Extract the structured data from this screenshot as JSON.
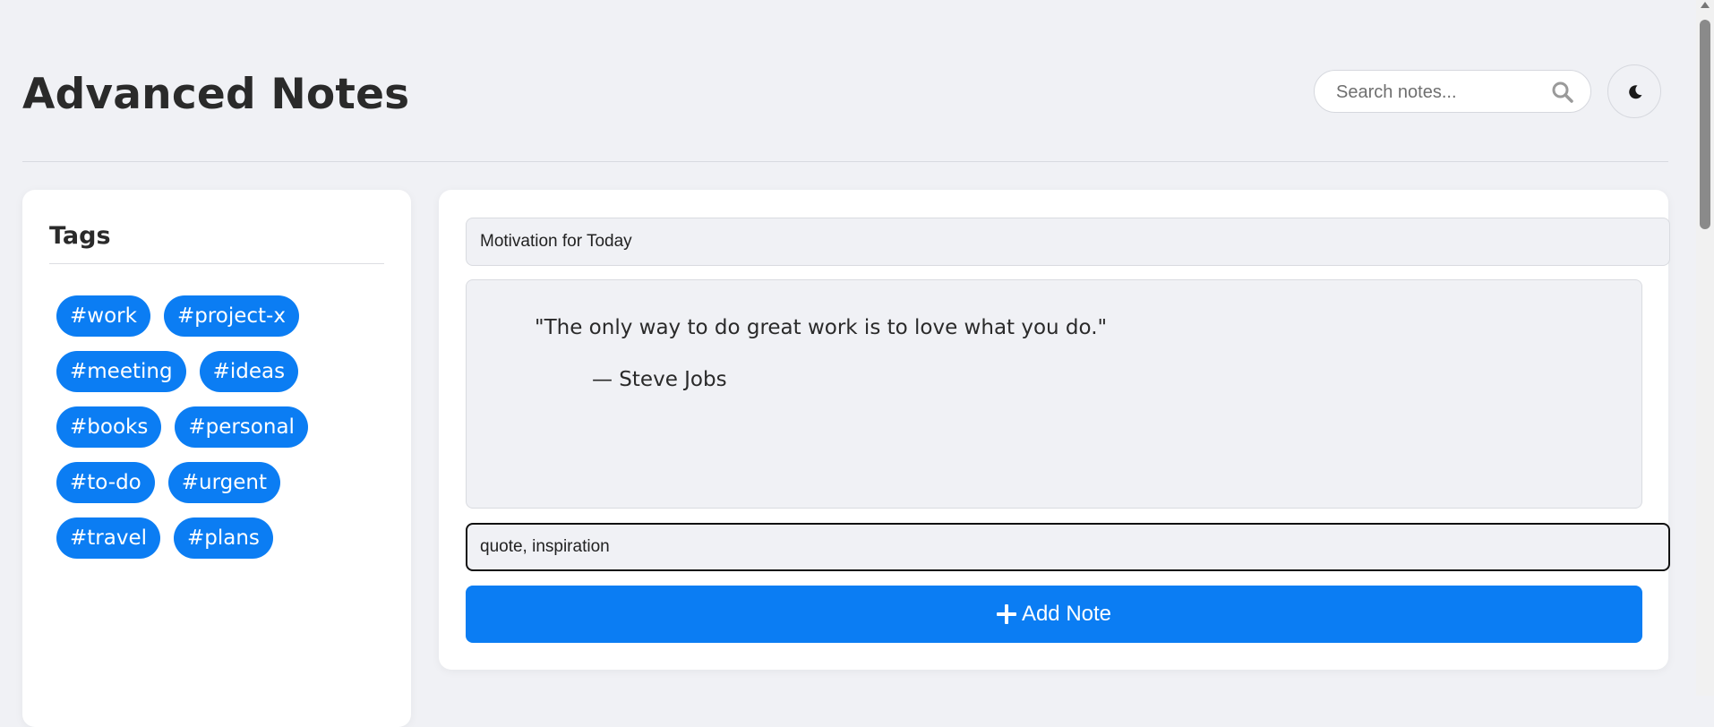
{
  "header": {
    "title": "Advanced Notes",
    "search": {
      "placeholder": "Search notes...",
      "value": ""
    },
    "theme_toggle_icon": "moon-icon"
  },
  "sidebar": {
    "title": "Tags",
    "tags": [
      "#work",
      "#project-x",
      "#meeting",
      "#ideas",
      "#books",
      "#personal",
      "#to-do",
      "#urgent",
      "#travel",
      "#plans"
    ]
  },
  "editor": {
    "title_value": "Motivation for Today",
    "quote": "\"The only way to do great work is to love what you do.\"",
    "author": "— Steve Jobs",
    "tags_value": "quote, inspiration",
    "add_button_label": "Add Note",
    "add_button_icon": "plus-icon"
  },
  "colors": {
    "accent": "#0b7df3",
    "background": "#f0f1f5",
    "card": "#ffffff"
  }
}
